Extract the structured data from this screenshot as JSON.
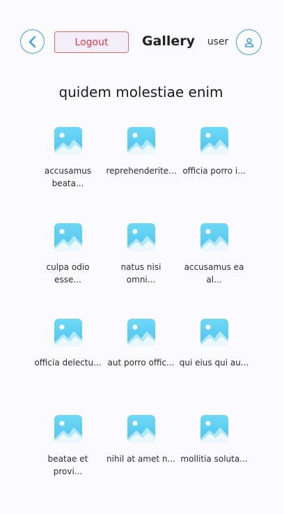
{
  "header": {
    "back_icon": "chevron-left-icon",
    "logout_label": "Logout",
    "title": "Gallery",
    "user_label": "user",
    "user_icon": "user-icon"
  },
  "album": {
    "title": "quidem molestiae enim"
  },
  "photos": [
    {
      "label": "accusamus beata...",
      "icon": "image-icon"
    },
    {
      "label": "reprehenderite...",
      "icon": "image-icon"
    },
    {
      "label": "officia porro i...",
      "icon": "image-icon"
    },
    {
      "label": "culpa odio esse...",
      "icon": "image-icon"
    },
    {
      "label": "natus nisi omni...",
      "icon": "image-icon"
    },
    {
      "label": "accusamus ea al...",
      "icon": "image-icon"
    },
    {
      "label": "officia delectu...",
      "icon": "image-icon"
    },
    {
      "label": "aut porro offic...",
      "icon": "image-icon"
    },
    {
      "label": "qui eius qui au...",
      "icon": "image-icon"
    },
    {
      "label": "beatae et provi...",
      "icon": "image-icon"
    },
    {
      "label": "nihil at amet n...",
      "icon": "image-icon"
    },
    {
      "label": "mollitia soluta...",
      "icon": "image-icon"
    }
  ],
  "colors": {
    "accent": "#3aa0db",
    "logout": "#e0393e",
    "thumb_top": "#6fd9f5",
    "thumb_bottom": "#4cc3ee"
  }
}
